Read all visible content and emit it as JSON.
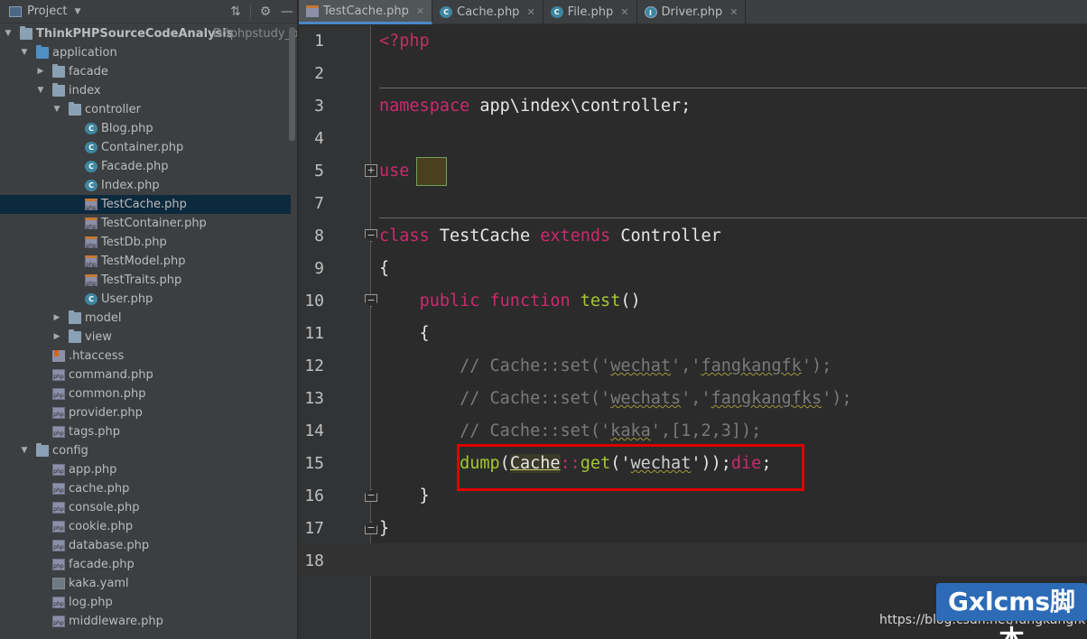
{
  "project_panel": {
    "title": "Project",
    "tree": [
      {
        "label": "ThinkPHPSourceCodeAnalysis",
        "path": "D:\\phpstudy_pro\\",
        "type": "folder",
        "depth": 0,
        "expanded": true
      },
      {
        "label": "application",
        "type": "folder-blue",
        "depth": 1,
        "expanded": true
      },
      {
        "label": "facade",
        "type": "folder",
        "depth": 2,
        "expanded": false
      },
      {
        "label": "index",
        "type": "folder",
        "depth": 2,
        "expanded": true
      },
      {
        "label": "controller",
        "type": "folder",
        "depth": 3,
        "expanded": true
      },
      {
        "label": "Blog.php",
        "type": "class",
        "depth": 4
      },
      {
        "label": "Container.php",
        "type": "class",
        "depth": 4
      },
      {
        "label": "Facade.php",
        "type": "class",
        "depth": 4
      },
      {
        "label": "Index.php",
        "type": "class",
        "depth": 4
      },
      {
        "label": "TestCache.php",
        "type": "php-orange",
        "depth": 4,
        "selected": true
      },
      {
        "label": "TestContainer.php",
        "type": "php-orange",
        "depth": 4
      },
      {
        "label": "TestDb.php",
        "type": "php-orange",
        "depth": 4
      },
      {
        "label": "TestModel.php",
        "type": "php-orange",
        "depth": 4
      },
      {
        "label": "TestTraits.php",
        "type": "php-orange",
        "depth": 4
      },
      {
        "label": "User.php",
        "type": "class",
        "depth": 4
      },
      {
        "label": "model",
        "type": "folder",
        "depth": 3,
        "expanded": false
      },
      {
        "label": "view",
        "type": "folder",
        "depth": 3,
        "expanded": false
      },
      {
        "label": ".htaccess",
        "type": "htaccess",
        "depth": 2
      },
      {
        "label": "command.php",
        "type": "php",
        "depth": 2
      },
      {
        "label": "common.php",
        "type": "php",
        "depth": 2
      },
      {
        "label": "provider.php",
        "type": "php",
        "depth": 2
      },
      {
        "label": "tags.php",
        "type": "php",
        "depth": 2
      },
      {
        "label": "config",
        "type": "folder",
        "depth": 1,
        "expanded": true
      },
      {
        "label": "app.php",
        "type": "php",
        "depth": 2
      },
      {
        "label": "cache.php",
        "type": "php",
        "depth": 2
      },
      {
        "label": "console.php",
        "type": "php",
        "depth": 2
      },
      {
        "label": "cookie.php",
        "type": "php",
        "depth": 2
      },
      {
        "label": "database.php",
        "type": "php",
        "depth": 2
      },
      {
        "label": "facade.php",
        "type": "php",
        "depth": 2
      },
      {
        "label": "kaka.yaml",
        "type": "yaml",
        "depth": 2
      },
      {
        "label": "log.php",
        "type": "php",
        "depth": 2
      },
      {
        "label": "middleware.php",
        "type": "php",
        "depth": 2
      }
    ]
  },
  "tabs": [
    {
      "label": "TestCache.php",
      "icon": "php-file-icon",
      "active": true
    },
    {
      "label": "Cache.php",
      "icon": "class-file-icon",
      "active": false
    },
    {
      "label": "File.php",
      "icon": "class-file-icon",
      "active": false
    },
    {
      "label": "Driver.php",
      "icon": "interface-file-icon",
      "active": false
    }
  ],
  "editor": {
    "line_numbers": [
      "1",
      "2",
      "3",
      "4",
      "5",
      "7",
      "8",
      "9",
      "10",
      "11",
      "12",
      "13",
      "14",
      "15",
      "16",
      "17",
      "18"
    ],
    "lines": {
      "l1": {
        "tag": "<?php"
      },
      "l3": {
        "kw": "namespace",
        "rest": " app\\index\\controller;"
      },
      "l5": {
        "kw": "use"
      },
      "l8": {
        "kw1": "class",
        "name": " TestCache ",
        "kw2": "extends",
        "parent": " Controller"
      },
      "l9": {
        "text": "{"
      },
      "l10": {
        "indent": "    ",
        "kw1": "public",
        "kw2": "function",
        "fn": "test",
        "rest": "()"
      },
      "l11": {
        "text": "    {"
      },
      "l12": {
        "a": "        // Cache::set('",
        "s1": "wechat",
        "b": "','",
        "s2": "fangkangfk",
        "c": "');"
      },
      "l13": {
        "a": "        // Cache::set('",
        "s1": "wechats",
        "b": "','",
        "s2": "fangkangfks",
        "c": "');"
      },
      "l14": {
        "a": "        // Cache::set('",
        "s1": "kaka",
        "b": "',[1,2,3]);"
      },
      "l15": {
        "indent": "        ",
        "fn1": "dump",
        "p1": "(",
        "cls": "Cache",
        "op": "::",
        "fn2": "get",
        "p2": "('",
        "s1": "wechat",
        "p3": "'));",
        "kw": "die",
        "end": ";"
      },
      "l16": {
        "text": "    }"
      },
      "l17": {
        "text": "}"
      }
    }
  },
  "watermark": {
    "url": "https://blog.csdn.net/fangkangfk",
    "logo": "Gxlcms脚本"
  }
}
